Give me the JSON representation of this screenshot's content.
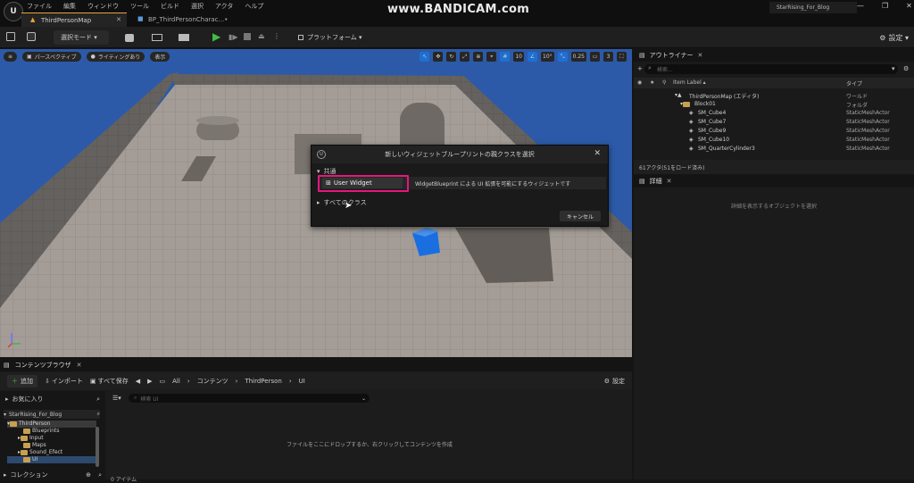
{
  "menu": [
    "ファイル",
    "編集",
    "ウィンドウ",
    "ツール",
    "ビルド",
    "選択",
    "アクタ",
    "ヘルプ"
  ],
  "tabs": [
    "ThirdPersonMap",
    "BP_ThirdPersonCharac...•"
  ],
  "watermark": "www.BANDICAM.com",
  "project_name": "StarRising_For_Blog",
  "window_buttons": [
    "—",
    "❐",
    "✕"
  ],
  "toolbar": {
    "select_mode": "選択モード ▾",
    "platform": "プラットフォーム ▾",
    "settings": "設定 ▾"
  },
  "viewport": {
    "perspective": "パースペクティブ",
    "lighting": "ライティングあり",
    "show": "表示",
    "grid_snap": "10",
    "rot_snap": "10°",
    "scale_snap": "0.25",
    "camera_speed": "3"
  },
  "dialog": {
    "title": "新しいウィジェットブループリントの親クラスを選択",
    "common": "共通",
    "option_label": "User Widget",
    "option_desc": "WidgetBlueprint による UI 拡張を可能にするウィジェットです",
    "all_classes": "すべてのクラス",
    "cancel": "キャンセル"
  },
  "outliner": {
    "title": "アウトライナー",
    "search_placeholder": "検索...",
    "col_label": "Item Label ▴",
    "col_type": "タイプ",
    "rows": [
      {
        "label": "ThirdPersonMap (エディタ)",
        "type": "ワールド"
      },
      {
        "label": "Block01",
        "type": "フォルダ"
      },
      {
        "label": "SM_Cube4",
        "type": "StaticMeshActor"
      },
      {
        "label": "SM_Cube7",
        "type": "StaticMeshActor"
      },
      {
        "label": "SM_Cube9",
        "type": "StaticMeshActor"
      },
      {
        "label": "SM_Cube10",
        "type": "StaticMeshActor"
      },
      {
        "label": "SM_QuarterCylinder3",
        "type": "StaticMeshActor"
      }
    ],
    "count": "61アクタ(51をロード済み)"
  },
  "details": {
    "title": "詳細",
    "empty": "詳細を表示するオブジェクトを選択"
  },
  "content_browser": {
    "title": "コンテンツブラウザ",
    "add": "追加",
    "import": "インポート",
    "save_all": "すべて保存",
    "path": [
      "All",
      "コンテンツ",
      "ThirdPerson",
      "UI"
    ],
    "settings": "設定",
    "favorites": "お気に入り",
    "root": "StarRising_For_Blog",
    "search_placeholder": "検索 UI",
    "tree": [
      "ThirdPerson",
      "Blueprints",
      "Input",
      "Maps",
      "Sound_Efect",
      "UI"
    ],
    "collection": "コレクション",
    "drop_hint": "ファイルをここにドロップするか、右クリックしてコンテンツを作成",
    "item_count": "0 アイテム"
  },
  "colors": {
    "accent": "#1f6fd1",
    "highlight": "#e6167c",
    "folder": "#c8a050",
    "play": "#3fbf3f"
  }
}
